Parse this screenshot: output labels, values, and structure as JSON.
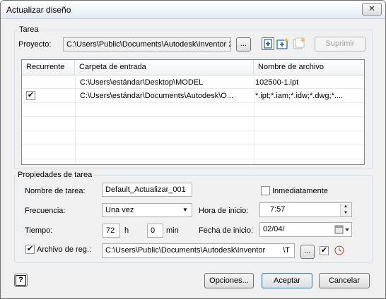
{
  "window": {
    "title": "Actualizar diseño",
    "close_glyph": "✕"
  },
  "task_group": {
    "title": "Tarea",
    "project_label": "Proyecto:",
    "project_value": "C:\\Users\\Public\\Documents\\Autodesk\\Inventor 2",
    "browse_label": "...",
    "delete_label": "Suprimir"
  },
  "grid": {
    "columns": [
      "Recurrente",
      "Carpeta de entrada",
      "Nombre de archivo"
    ],
    "rows": [
      {
        "recurring": "",
        "folder": "C:\\Users\\estándar\\Desktop\\MODEL",
        "filename": "102500-1.ipt"
      },
      {
        "recurring": "✔",
        "folder": "C:\\Users\\estándar\\Documents\\Autodesk\\O...",
        "filename": "*.ipt;*.iam;*.idw;*.dwg;*...."
      }
    ]
  },
  "props_group": {
    "title": "Propiedades de tarea",
    "name_label": "Nombre de tarea:",
    "name_value": "Default_Actualizar_001",
    "immediate_label": "Inmediatamente",
    "frequency_label": "Frecuencia:",
    "frequency_value": "Una vez",
    "start_time_label": "Hora de inicio:",
    "start_time_value": "7:57",
    "time_label": "Tiempo:",
    "hours_value": "72",
    "hours_unit": "h",
    "minutes_value": "0",
    "minutes_unit": "min",
    "start_date_label": "Fecha de inicio:",
    "start_date_value": "02/04/",
    "log_label": "Archivo de reg.:",
    "log_checked": "✔",
    "log_value": "C:\\Users\\Public\\Documents\\Autodesk\\Inventor",
    "log_suffix": "\\T",
    "log_browse_label": "...",
    "log_open_checked": "✔"
  },
  "footer": {
    "help_label": "?",
    "options_label": "Opciones...",
    "accept_label": "Aceptar",
    "cancel_label": "Cancelar"
  },
  "colors": {
    "accent": "#3c7fb1",
    "icon_blue": "#1b5fb4",
    "icon_yellow": "#e8b73a"
  }
}
